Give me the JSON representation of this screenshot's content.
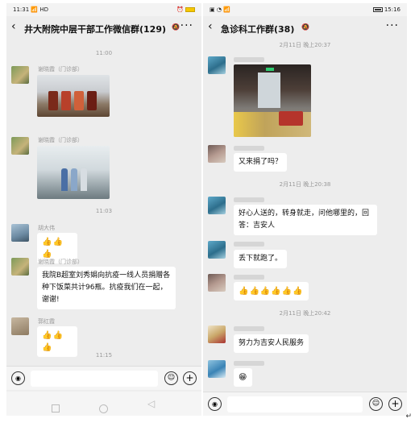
{
  "left": {
    "status": {
      "time": "11:31",
      "signal": "📶 HD"
    },
    "title": "井大附院中层干部工作微信群(129)",
    "times": [
      "11:00",
      "11:03",
      "11:15"
    ],
    "messages": [
      {
        "sender": "谢晓霞（门诊部）",
        "type": "photo"
      },
      {
        "sender": "谢晓霞（门诊部）",
        "type": "photo"
      },
      {
        "sender": "胡大伟",
        "text": "👍👍👍"
      },
      {
        "sender": "谢晓霞（门诊部）",
        "text": "我院B超室刘秀娟向抗疫一线人员捐赠各种下饭菜共计96瓶。抗疫我们在一起，谢谢!"
      },
      {
        "sender": "郭红霞",
        "text": "👍👍👍"
      }
    ]
  },
  "right": {
    "status": {
      "time": "15:16"
    },
    "title": "急诊科工作群(38)",
    "times": [
      "2月11日 晚上20:37",
      "2月11日 晚上20:38",
      "2月11日 晚上20:42"
    ],
    "messages": [
      {
        "type": "photo"
      },
      {
        "text": "又来捐了吗？"
      },
      {
        "text": "好心人送的，转身就走，问他哪里的，回答：吉安人"
      },
      {
        "text": "丢下就跑了。"
      },
      {
        "text": "👍👍👍👍👍👍"
      },
      {
        "text": "努力为吉安人民服务"
      },
      {
        "text": "😁"
      }
    ]
  },
  "icons": {
    "back": "‹",
    "more": "···",
    "voice": "◉",
    "emoji": "☺",
    "plus": "+",
    "mute": "🔕",
    "caret": "↵"
  }
}
